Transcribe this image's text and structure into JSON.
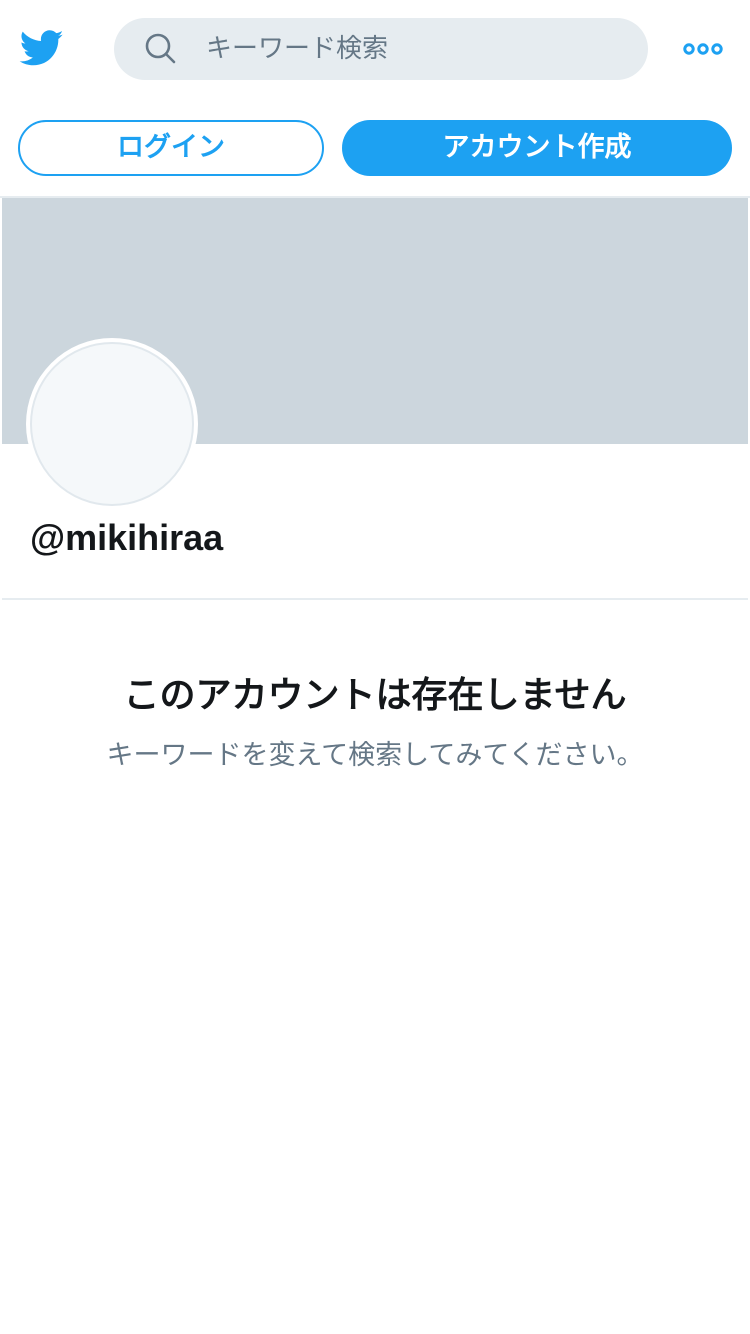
{
  "colors": {
    "brand": "#1da1f2",
    "search_bg": "#e6ecf0",
    "banner": "#ccd6dd",
    "text_primary": "#14171a",
    "text_secondary": "#657786"
  },
  "header": {
    "logo_icon": "twitter-bird-icon",
    "search": {
      "icon": "search-icon",
      "placeholder": "キーワード検索",
      "value": ""
    },
    "more_icon": "more-options-icon"
  },
  "auth": {
    "login_label": "ログイン",
    "signup_label": "アカウント作成"
  },
  "profile": {
    "handle": "@mikihiraa"
  },
  "empty_state": {
    "title": "このアカウントは存在しません",
    "subtitle": "キーワードを変えて検索してみてください。"
  }
}
